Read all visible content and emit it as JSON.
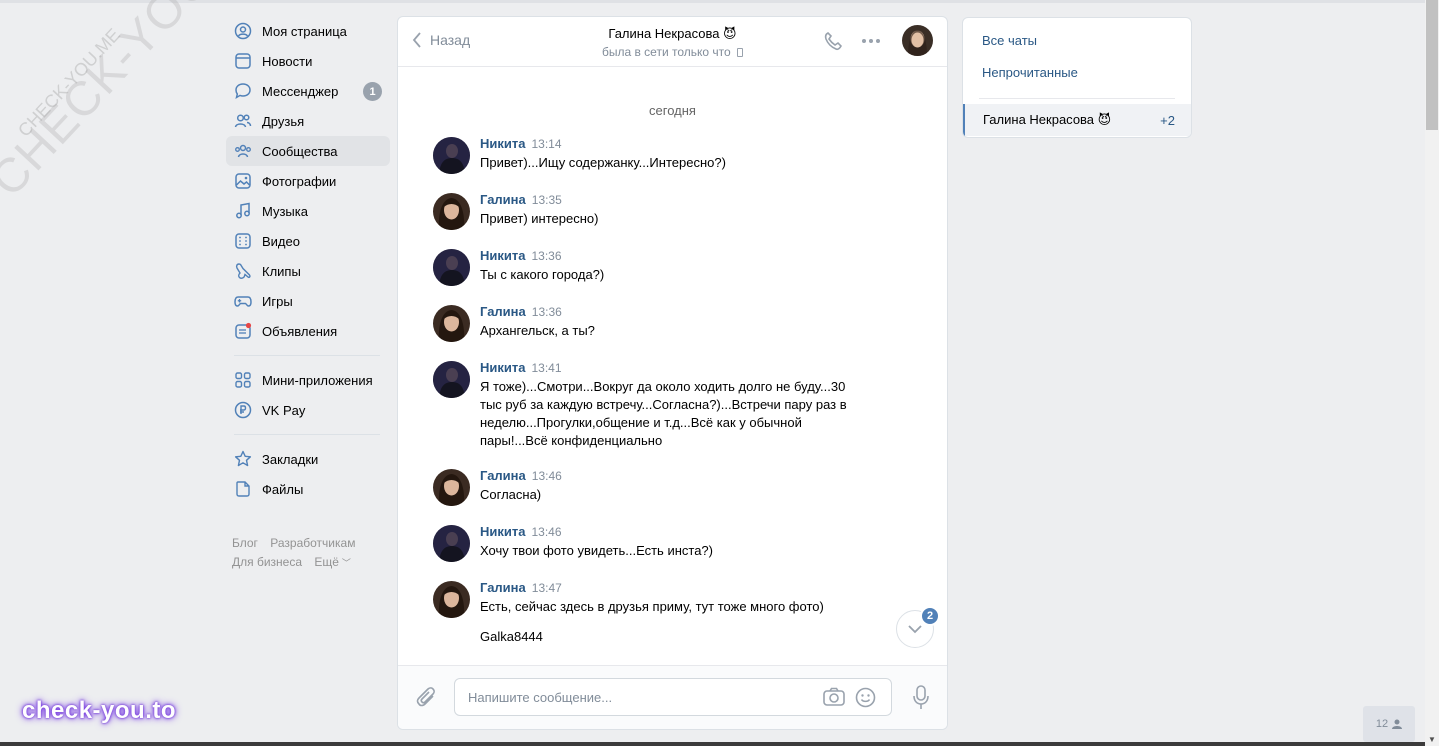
{
  "nav": {
    "items": [
      {
        "label": "Моя страница",
        "icon": "user-circle-icon"
      },
      {
        "label": "Новости",
        "icon": "news-icon"
      },
      {
        "label": "Мессенджер",
        "icon": "message-icon",
        "badge": "1"
      },
      {
        "label": "Друзья",
        "icon": "friends-icon"
      },
      {
        "label": "Сообщества",
        "icon": "communities-icon",
        "active": true
      },
      {
        "label": "Фотографии",
        "icon": "photo-icon"
      },
      {
        "label": "Музыка",
        "icon": "music-icon"
      },
      {
        "label": "Видео",
        "icon": "video-icon"
      },
      {
        "label": "Клипы",
        "icon": "clips-icon"
      },
      {
        "label": "Игры",
        "icon": "gamepad-icon"
      },
      {
        "label": "Объявления",
        "icon": "ads-icon"
      }
    ],
    "items2": [
      {
        "label": "Мини-приложения",
        "icon": "apps-icon"
      },
      {
        "label": "VK Pay",
        "icon": "vkpay-icon"
      }
    ],
    "items3": [
      {
        "label": "Закладки",
        "icon": "star-icon"
      },
      {
        "label": "Файлы",
        "icon": "file-icon"
      }
    ],
    "footer": [
      "Блог",
      "Разработчикам",
      "Для бизнеса",
      "Ещё"
    ]
  },
  "watermark": {
    "big": "CHECK-YOU.ME",
    "small": "CHECK-YOU.ME",
    "brand": "check-you.to"
  },
  "chat": {
    "back_label": "Назад",
    "peer_name": "Галина Некрасова 😈",
    "peer_status": "была в сети только что",
    "date_separator": "сегодня",
    "messages": [
      {
        "author": "Никита",
        "time": "13:14",
        "text": "Привет)...Ищу содержанку...Интересно?)",
        "avatar": "nikita"
      },
      {
        "author": "Галина",
        "time": "13:35",
        "text": "Привет) интересно)",
        "avatar": "galina"
      },
      {
        "author": "Никита",
        "time": "13:36",
        "text": "Ты с какого города?)",
        "avatar": "nikita"
      },
      {
        "author": "Галина",
        "time": "13:36",
        "text": "Архангельск, а ты?",
        "avatar": "galina"
      },
      {
        "author": "Никита",
        "time": "13:41",
        "text": "Я тоже)...Смотри...Вокруг да около ходить долго не буду...30 тыс руб за каждую встречу...Согласна?)...Встречи пару раз в неделю...Прогулки,общение и т.д...Всё как у обычной пары!...Всё конфиденциально",
        "avatar": "nikita"
      },
      {
        "author": "Галина",
        "time": "13:46",
        "text": "Согласна)",
        "avatar": "galina"
      },
      {
        "author": "Никита",
        "time": "13:46",
        "text": "Хочу твои фото увидеть...Есть инста?)",
        "avatar": "nikita"
      },
      {
        "author": "Галина",
        "time": "13:47",
        "text": "Есть, сейчас здесь в друзья приму, тут тоже много фото)",
        "extra": "Galka8444",
        "avatar": "galina"
      }
    ],
    "unread_badge": "2",
    "composer_placeholder": "Напишите сообщение..."
  },
  "right_panel": {
    "all_chats": "Все чаты",
    "unread": "Непрочитанные",
    "chat_name": "Галина Некрасова 😈",
    "chat_count": "+2"
  },
  "online_widget": "12",
  "colors": {
    "link": "#2a5885",
    "accent": "#5181b8",
    "bg": "#edeef0"
  }
}
